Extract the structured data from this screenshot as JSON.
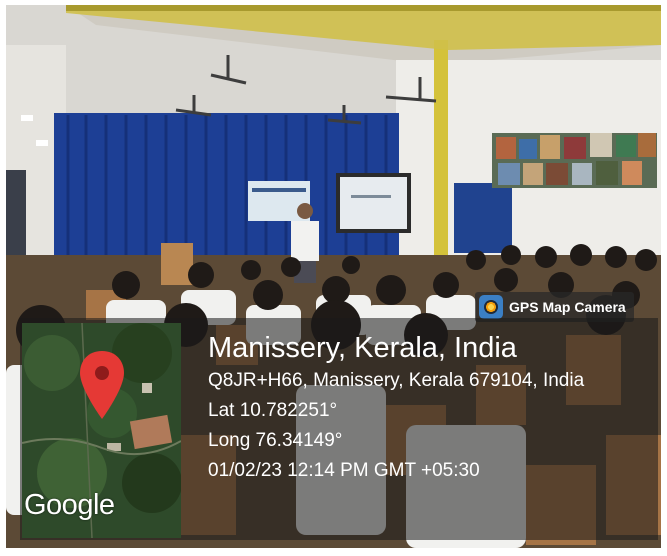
{
  "app_badge": {
    "label": "GPS Map Camera",
    "icon": "gps-map-camera-icon"
  },
  "location": {
    "title": "Manissery, Kerala, India",
    "address": "Q8JR+H66, Manissery, Kerala 679104, India",
    "lat": "Lat 10.782251°",
    "long": "Long 76.34149°",
    "datetime": "01/02/23 12:14 PM GMT +05:30"
  },
  "map": {
    "brand": "Google",
    "pin_icon": "map-pin-icon",
    "pin_color": "#e53935"
  },
  "colors": {
    "curtain": "#1c3c8c",
    "wall": "#ecebe6",
    "pillar": "#d4c23a"
  }
}
